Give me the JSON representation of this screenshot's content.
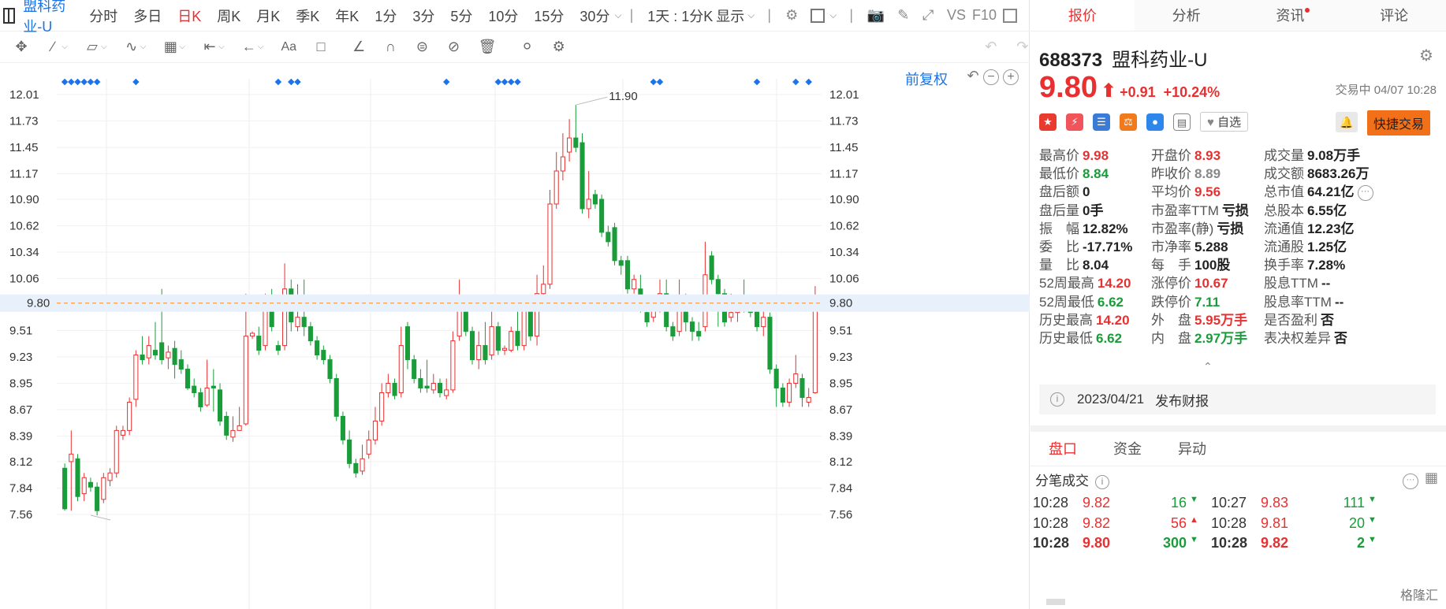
{
  "topbar": {
    "symbol": "盟科药业-U",
    "periods": [
      "分时",
      "多日",
      "日K",
      "周K",
      "月K",
      "季K",
      "年K",
      "1分",
      "3分",
      "5分",
      "10分",
      "15分",
      "30分"
    ],
    "active_period": "日K",
    "range_label": "1天 : 1分K",
    "display_label": "显示",
    "right_labels": [
      "VS",
      "F10"
    ]
  },
  "chart": {
    "adjust_label": "前复权",
    "price_ticks": [
      "12.01",
      "11.73",
      "11.45",
      "11.17",
      "10.90",
      "10.62",
      "10.34",
      "10.06",
      "9.80",
      "9.51",
      "9.23",
      "8.95",
      "8.67",
      "8.39",
      "8.12",
      "7.84",
      "7.56"
    ],
    "current_price_label": "9.80",
    "high_marker": "11.90",
    "colors": {
      "up": "#e93030",
      "down": "#1a9c3a",
      "marker": "#1a73e8",
      "current": "#ff8c1a"
    }
  },
  "chart_data": {
    "type": "candlestick",
    "ylim": [
      7.56,
      12.01
    ],
    "grid": true,
    "candles": [
      [
        8.05,
        7.62,
        8.1,
        7.6
      ],
      [
        8.12,
        8.2,
        8.45,
        7.6
      ],
      [
        8.15,
        7.75,
        8.2,
        7.7
      ],
      [
        7.78,
        7.95,
        8.0,
        7.7
      ],
      [
        7.9,
        7.85,
        7.95,
        7.8
      ],
      [
        7.85,
        7.6,
        7.9,
        7.55
      ],
      [
        7.72,
        7.95,
        8.0,
        7.68
      ],
      [
        7.92,
        8.0,
        8.05,
        7.86
      ],
      [
        8.0,
        8.45,
        8.5,
        7.95
      ],
      [
        8.4,
        8.45,
        8.5,
        8.35
      ],
      [
        8.45,
        8.75,
        8.8,
        8.4
      ],
      [
        8.78,
        9.25,
        9.3,
        8.7
      ],
      [
        9.25,
        9.2,
        9.45,
        9.15
      ],
      [
        9.22,
        9.35,
        9.45,
        9.15
      ],
      [
        9.3,
        9.25,
        9.6,
        9.2
      ],
      [
        9.38,
        9.2,
        9.95,
        9.15
      ],
      [
        9.22,
        9.28,
        9.35,
        9.1
      ],
      [
        9.32,
        9.15,
        9.4,
        9.0
      ],
      [
        9.2,
        9.1,
        9.3,
        9.05
      ],
      [
        9.1,
        8.9,
        9.15,
        8.88
      ],
      [
        8.92,
        8.85,
        9.0,
        8.8
      ],
      [
        8.85,
        8.7,
        8.9,
        8.65
      ],
      [
        8.72,
        8.9,
        9.2,
        8.7
      ],
      [
        8.92,
        8.9,
        9.1,
        8.65
      ],
      [
        8.88,
        8.55,
        8.95,
        8.5
      ],
      [
        8.6,
        8.4,
        8.65,
        8.35
      ],
      [
        8.38,
        8.45,
        8.6,
        8.33
      ],
      [
        8.45,
        8.5,
        8.7,
        8.45
      ],
      [
        8.52,
        9.45,
        9.9,
        8.5
      ],
      [
        9.45,
        9.48,
        9.5,
        9.42
      ],
      [
        9.45,
        9.3,
        9.55,
        9.25
      ],
      [
        9.35,
        9.75,
        9.9,
        9.3
      ],
      [
        9.75,
        9.55,
        9.95,
        9.5
      ],
      [
        9.35,
        9.3,
        9.4,
        9.25
      ],
      [
        9.35,
        9.95,
        10.22,
        9.3
      ],
      [
        9.95,
        9.6,
        10.05,
        9.5
      ],
      [
        9.55,
        9.65,
        10.0,
        9.5
      ],
      [
        9.65,
        9.55,
        10.05,
        9.45
      ],
      [
        9.55,
        9.4,
        9.6,
        9.35
      ],
      [
        9.4,
        9.25,
        9.45,
        9.2
      ],
      [
        9.3,
        9.2,
        9.35,
        9.15
      ],
      [
        9.2,
        9.0,
        9.25,
        8.95
      ],
      [
        9.0,
        8.6,
        9.05,
        8.55
      ],
      [
        8.6,
        8.35,
        8.65,
        8.3
      ],
      [
        8.35,
        8.1,
        8.45,
        8.05
      ],
      [
        8.1,
        8.0,
        8.15,
        7.95
      ],
      [
        8.02,
        8.15,
        8.3,
        7.98
      ],
      [
        8.2,
        8.35,
        8.45,
        8.15
      ],
      [
        8.35,
        8.55,
        8.7,
        8.3
      ],
      [
        8.55,
        8.85,
        8.95,
        8.5
      ],
      [
        8.85,
        8.95,
        9.05,
        8.8
      ],
      [
        8.95,
        8.82,
        9.0,
        8.78
      ],
      [
        8.85,
        9.35,
        9.55,
        8.8
      ],
      [
        9.55,
        9.2,
        9.6,
        9.1
      ],
      [
        9.2,
        9.0,
        9.25,
        8.95
      ],
      [
        9.0,
        8.9,
        9.1,
        8.85
      ],
      [
        8.92,
        8.9,
        9.2,
        8.85
      ],
      [
        8.88,
        8.95,
        9.05,
        8.84
      ],
      [
        8.95,
        8.85,
        9.0,
        8.8
      ],
      [
        8.82,
        8.88,
        9.0,
        8.78
      ],
      [
        8.88,
        9.4,
        9.5,
        8.85
      ],
      [
        9.45,
        9.8,
        10.05,
        9.4
      ],
      [
        9.8,
        9.5,
        9.85,
        9.45
      ],
      [
        9.5,
        9.2,
        9.55,
        9.15
      ],
      [
        9.2,
        9.35,
        9.5,
        9.1
      ],
      [
        9.35,
        9.2,
        9.6,
        9.15
      ],
      [
        9.25,
        9.55,
        9.75,
        9.2
      ],
      [
        9.55,
        9.3,
        9.6,
        9.25
      ],
      [
        9.3,
        9.32,
        9.35,
        9.25
      ],
      [
        9.3,
        9.5,
        9.55,
        9.28
      ],
      [
        9.5,
        9.35,
        9.8,
        9.3
      ],
      [
        9.35,
        9.8,
        9.85,
        9.3
      ],
      [
        9.78,
        9.45,
        9.85,
        9.4
      ],
      [
        9.45,
        9.9,
        10.1,
        9.35
      ],
      [
        9.9,
        10.0,
        10.2,
        9.85
      ],
      [
        10.0,
        10.85,
        11.0,
        9.95
      ],
      [
        10.85,
        11.2,
        11.4,
        10.8
      ],
      [
        11.2,
        11.35,
        11.6,
        11.1
      ],
      [
        11.4,
        11.55,
        11.75,
        11.3
      ],
      [
        11.55,
        11.45,
        11.9,
        11.4
      ],
      [
        11.5,
        10.8,
        11.6,
        10.75
      ],
      [
        10.8,
        10.9,
        11.2,
        10.7
      ],
      [
        10.95,
        10.85,
        11.0,
        10.8
      ],
      [
        10.9,
        10.55,
        10.95,
        10.5
      ],
      [
        10.55,
        10.45,
        10.62,
        10.4
      ],
      [
        10.6,
        10.25,
        10.65,
        10.2
      ],
      [
        10.25,
        10.2,
        10.3,
        10.1
      ],
      [
        10.25,
        9.95,
        10.3,
        9.9
      ],
      [
        9.95,
        10.05,
        10.1,
        9.9
      ],
      [
        9.95,
        9.8,
        10.1,
        9.7
      ],
      [
        9.7,
        9.6,
        9.75,
        9.55
      ],
      [
        9.65,
        9.75,
        9.8,
        9.6
      ],
      [
        9.75,
        9.9,
        10.05,
        9.7
      ],
      [
        9.9,
        9.55,
        10.05,
        9.5
      ],
      [
        9.55,
        9.45,
        9.6,
        9.4
      ],
      [
        9.5,
        9.85,
        10.05,
        9.45
      ],
      [
        9.85,
        9.6,
        9.9,
        9.5
      ],
      [
        9.6,
        9.5,
        9.65,
        9.4
      ],
      [
        9.5,
        9.45,
        9.6,
        9.4
      ],
      [
        9.55,
        10.1,
        10.45,
        9.5
      ],
      [
        10.3,
        10.05,
        10.35,
        10.0
      ],
      [
        10.05,
        9.9,
        10.1,
        9.55
      ],
      [
        9.9,
        9.6,
        9.95,
        9.55
      ],
      [
        9.65,
        9.7,
        9.9,
        9.6
      ],
      [
        9.7,
        9.8,
        9.85,
        9.6
      ],
      [
        9.88,
        9.75,
        10.05,
        9.7
      ],
      [
        9.75,
        9.7,
        9.8,
        9.65
      ],
      [
        9.72,
        9.55,
        9.75,
        9.5
      ],
      [
        9.55,
        9.65,
        9.8,
        9.45
      ],
      [
        9.65,
        9.1,
        9.7,
        9.05
      ],
      [
        9.1,
        8.9,
        9.15,
        8.7
      ],
      [
        8.9,
        8.75,
        8.95,
        8.7
      ],
      [
        8.75,
        8.95,
        9.0,
        8.7
      ],
      [
        8.95,
        9.05,
        9.25,
        8.9
      ],
      [
        9.0,
        8.8,
        9.05,
        8.7
      ],
      [
        8.75,
        8.8,
        8.9,
        8.7
      ],
      [
        8.85,
        9.8,
        9.98,
        8.84
      ]
    ],
    "markers_count": 20
  },
  "quote": {
    "tabs": [
      "报价",
      "分析",
      "资讯",
      "评论"
    ],
    "active_tab": "报价",
    "code": "688373",
    "name": "盟科药业-U",
    "price": "9.80",
    "change": "+0.91",
    "change_pct": "+10.24%",
    "status": "交易中 04/07 10:28",
    "fav_label": "自选",
    "quick_trade": "快捷交易",
    "fields": [
      [
        [
          "最高价",
          "9.98",
          "red"
        ],
        [
          "开盘价",
          "8.93",
          "red"
        ],
        [
          "成交量",
          "9.08万手",
          "dark"
        ]
      ],
      [
        [
          "最低价",
          "8.84",
          "green"
        ],
        [
          "昨收价",
          "8.89",
          "gray"
        ],
        [
          "成交额",
          "8683.26万",
          "dark"
        ]
      ],
      [
        [
          "盘后额",
          "0",
          "dark"
        ],
        [
          "平均价",
          "9.56",
          "red"
        ],
        [
          "总市值",
          "64.21亿",
          "dark"
        ]
      ],
      [
        [
          "盘后量",
          "0手",
          "dark"
        ],
        [
          "市盈率TTM",
          "亏损",
          "dark"
        ],
        [
          "总股本",
          "6.55亿",
          "dark"
        ]
      ],
      [
        [
          "振　幅",
          "12.82%",
          "dark"
        ],
        [
          "市盈率(静)",
          "亏损",
          "dark"
        ],
        [
          "流通值",
          "12.23亿",
          "dark"
        ]
      ],
      [
        [
          "委　比",
          "-17.71%",
          "dark"
        ],
        [
          "市净率",
          "5.288",
          "dark"
        ],
        [
          "流通股",
          "1.25亿",
          "dark"
        ]
      ],
      [
        [
          "量　比",
          "8.04",
          "dark"
        ],
        [
          "每　手",
          "100股",
          "dark"
        ],
        [
          "换手率",
          "7.28%",
          "dark"
        ]
      ],
      [
        [
          "52周最高",
          "14.20",
          "red"
        ],
        [
          "涨停价",
          "10.67",
          "red"
        ],
        [
          "股息TTM",
          "--",
          "dark"
        ]
      ],
      [
        [
          "52周最低",
          "6.62",
          "green"
        ],
        [
          "跌停价",
          "7.11",
          "green"
        ],
        [
          "股息率TTM",
          "--",
          "dark"
        ]
      ],
      [
        [
          "历史最高",
          "14.20",
          "red"
        ],
        [
          "外　盘",
          "5.95万手",
          "red"
        ],
        [
          "是否盈利",
          "否",
          "dark"
        ]
      ],
      [
        [
          "历史最低",
          "6.62",
          "green"
        ],
        [
          "内　盘",
          "2.97万手",
          "green"
        ],
        [
          "表决权差异",
          "否",
          "dark"
        ]
      ]
    ],
    "report_date": "2023/04/21",
    "report_label": "发布财报"
  },
  "trades": {
    "subtabs": [
      "盘口",
      "资金",
      "异动"
    ],
    "active_subtab": "盘口",
    "title": "分笔成交",
    "rows": [
      [
        [
          "10:28",
          "9.82",
          "16",
          "down"
        ],
        [
          "10:27",
          "9.83",
          "111",
          "down"
        ]
      ],
      [
        [
          "10:28",
          "9.82",
          "56",
          "up"
        ],
        [
          "10:28",
          "9.81",
          "20",
          "down"
        ]
      ],
      [
        [
          "10:28",
          "9.80",
          "300",
          "down"
        ],
        [
          "10:28",
          "9.82",
          "2",
          "down"
        ]
      ]
    ],
    "watermark": "格隆汇"
  }
}
